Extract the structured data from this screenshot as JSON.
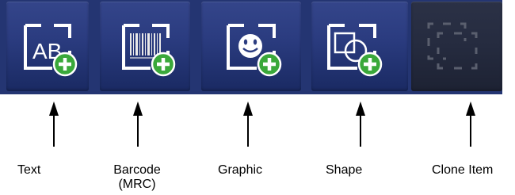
{
  "toolbar": {
    "buttons": [
      {
        "id": "text",
        "label": "Text",
        "icon": "text-ab-add-icon",
        "glyph": "AB",
        "enabled": true
      },
      {
        "id": "barcode",
        "label": "Barcode",
        "sublabel": "(MRC)",
        "icon": "barcode-add-icon",
        "enabled": true
      },
      {
        "id": "graphic",
        "label": "Graphic",
        "icon": "smiley-graphic-add-icon",
        "enabled": true
      },
      {
        "id": "shape",
        "label": "Shape",
        "icon": "shape-add-icon",
        "enabled": true
      },
      {
        "id": "clone",
        "label": "Clone Item",
        "icon": "clone-icon",
        "enabled": false
      }
    ]
  },
  "colors": {
    "toolbar_bg": "#243572",
    "button_face": "#2b3c80",
    "disabled_face": "#252b3f",
    "icon_white": "#ffffff",
    "plus_green": "#3aa83a",
    "disabled_icon": "#5a5f6e"
  }
}
